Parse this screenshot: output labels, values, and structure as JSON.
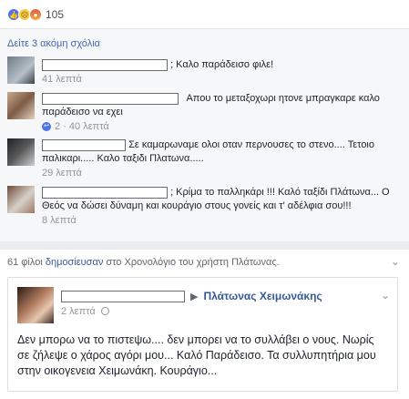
{
  "reactions": {
    "count": "105",
    "icons": [
      "like-icon",
      "sad-icon",
      "angry-icon"
    ]
  },
  "comments_section": {
    "more_comments": "Δείτε 3 ακόμη σχόλια",
    "comments": [
      {
        "text": "; Καλο παράδεισο φιλε!",
        "time": "41 λεπτά",
        "replies": ""
      },
      {
        "text": "Απου το μεταξοχωρι ητονε μπραγκαρε καλο παράδεισο να εχει",
        "time": "40 λεπτά",
        "replies": "2"
      },
      {
        "text": "Σε καμαρωναμε ολοι οταν περνουσες το στενο.... Τετοιο παλικαρι..... Καλο ταξιδι Πλατωνα.....",
        "time": "29 λεπτά",
        "replies": ""
      },
      {
        "text": "; Κρίμα το παλληκάρι !!! Καλό ταξίδι Πλάτωνα... Ο Θεός να δώσει δύναμη και κουράγιο στους γονείς και τ' αδέλφια σου!!!",
        "time": "8 λεπτά",
        "replies": ""
      }
    ]
  },
  "share": {
    "count_label": "61 φίλοι",
    "verb": "δημοσίευσαν",
    "rest": "στο Χρονολόγιο του χρήστη Πλάτωνας."
  },
  "post": {
    "target": "Πλάτωνας Χειμωνάκης",
    "time": "2 λεπτά",
    "body": "Δεν μπορω να το πιστεψω.... δεν μπορει να το συλλάβει ο νους. Νωρίς σε ζήλεψε ο χάρος αγόρι μου... Καλό Παράδεισο. Τα συλλυπητήρια μου στην οικογενεια Χειμωνάκη. Κουράγιο..."
  }
}
